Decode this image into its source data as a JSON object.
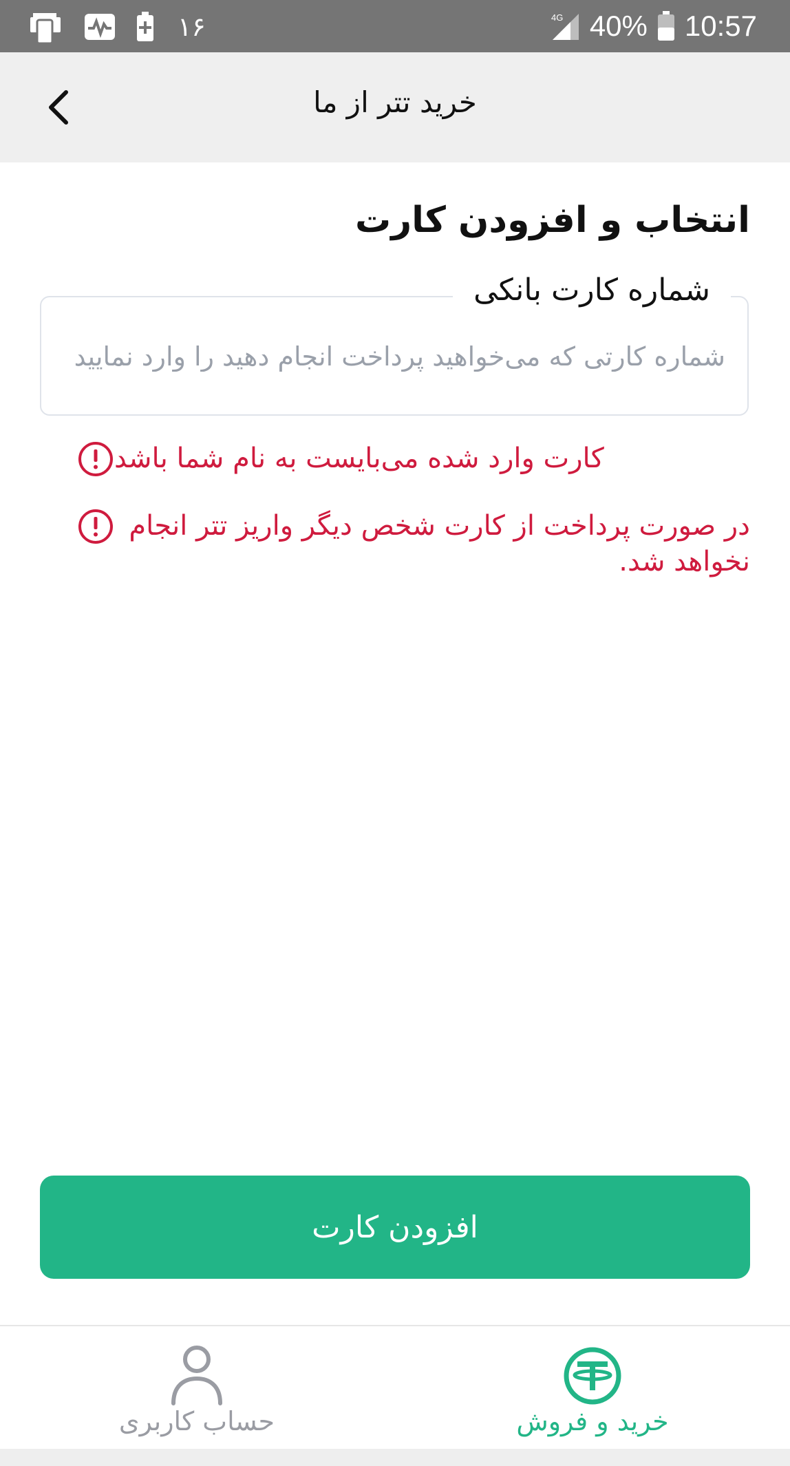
{
  "status_bar": {
    "notification_count": "۱۶",
    "network": "4G",
    "battery": "40%",
    "time": "10:57",
    "icons": [
      "phone-icon",
      "activity-icon",
      "battery-saver-icon",
      "signal-icon",
      "battery-icon"
    ]
  },
  "app_bar": {
    "title": "خرید تتر از ما",
    "back_icon": "chevron-left-icon"
  },
  "section": {
    "title": "انتخاب و افزودن کارت"
  },
  "card_field": {
    "label": "شماره کارت بانکی",
    "placeholder": "شماره کارتی که می‌خواهید پرداخت انجام دهید را وارد نمایید",
    "value": ""
  },
  "warnings": [
    "کارت وارد شده می‌بایست به نام شما باشد",
    "در صورت پرداخت از کارت شخص دیگر واریز تتر انجام نخواهد شد."
  ],
  "colors": {
    "accent": "#22b587",
    "warning": "#cf1b3e",
    "status_bar": "#757575",
    "app_bar": "#efefef"
  },
  "actions": {
    "add_card_label": "افزودن کارت"
  },
  "bottom_nav": {
    "items": [
      {
        "label": "حساب کاربری",
        "icon": "user-icon",
        "active": false
      },
      {
        "label": "خرید و فروش",
        "icon": "tether-icon",
        "active": true
      }
    ]
  }
}
